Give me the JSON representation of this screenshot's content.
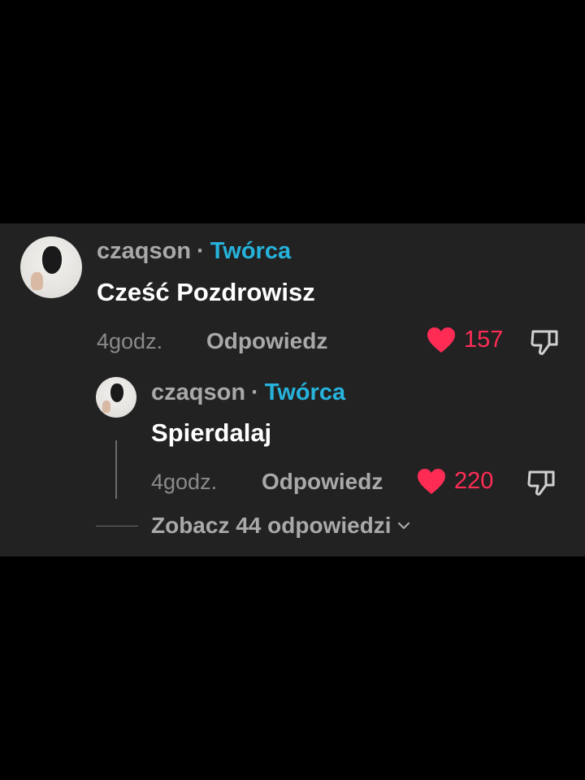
{
  "colors": {
    "background": "#000000",
    "panel": "#222222",
    "creator_badge": "#26b3dc",
    "like": "#fe2c55",
    "muted_text": "#a9a9a9"
  },
  "comment": {
    "username": "czaqson",
    "separator": "·",
    "badge": "Twórca",
    "text": "Cześć Pozdrowisz",
    "time": "4godz.",
    "reply_label": "Odpowiedz",
    "likes": "157",
    "like_icon": "heart-icon",
    "dislike_icon": "thumbs-down-icon"
  },
  "reply": {
    "username": "czaqson",
    "separator": "·",
    "badge": "Twórca",
    "text": "Spierdalaj",
    "time": "4godz.",
    "reply_label": "Odpowiedz",
    "likes": "220",
    "like_icon": "heart-icon",
    "dislike_icon": "thumbs-down-icon"
  },
  "view_replies": {
    "label": "Zobacz 44 odpowiedzi",
    "icon": "chevron-down-icon"
  }
}
